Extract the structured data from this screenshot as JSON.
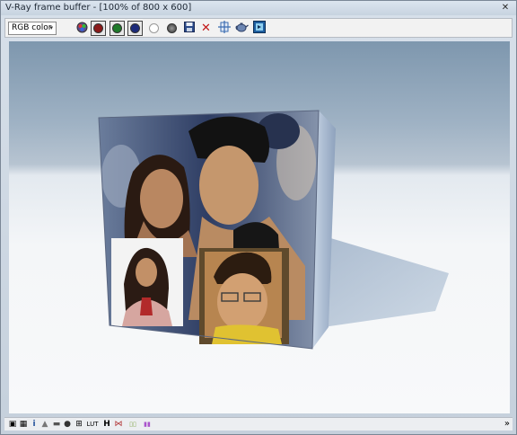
{
  "window": {
    "title": "V-Ray frame buffer - [100% of 800 x 600]",
    "close_glyph": "✕"
  },
  "toolbar": {
    "channel_select": {
      "value": "RGB color",
      "arrow": "▾"
    },
    "buttons": [
      {
        "name": "rgb-channels-icon",
        "color": "#6b5fa0"
      },
      {
        "name": "red-channel-icon",
        "color": "#8b1a1a"
      },
      {
        "name": "green-channel-icon",
        "color": "#1f7a2a"
      },
      {
        "name": "blue-channel-icon",
        "color": "#1c2a7a"
      },
      {
        "name": "alpha-channel-icon",
        "color": "#ffffff"
      },
      {
        "name": "mono-mode-icon",
        "color": "#555555"
      },
      {
        "name": "save-image-icon",
        "color": "#2b4a8a"
      },
      {
        "name": "clear-image-icon",
        "glyph": "✕",
        "color": "#c21818"
      },
      {
        "name": "duplicate-to-max-icon",
        "color": "#3a6bb0"
      },
      {
        "name": "render-last-icon",
        "color": "#4a6a9a"
      },
      {
        "name": "vfb-history-icon",
        "color": "#1f5fa0"
      }
    ]
  },
  "statusbar": {
    "icons": [
      {
        "name": "display-correction-icon",
        "glyph": "▣"
      },
      {
        "name": "pixel-info-icon",
        "glyph": "▦"
      },
      {
        "name": "info-icon",
        "glyph": "i"
      },
      {
        "name": "levels-icon",
        "glyph": "▲"
      },
      {
        "name": "curve-icon",
        "glyph": "▬"
      },
      {
        "name": "exposure-icon",
        "glyph": "●"
      },
      {
        "name": "srgb-icon",
        "glyph": "⊞"
      },
      {
        "name": "lut-icon",
        "glyph": "LUT"
      },
      {
        "name": "histogram-icon",
        "glyph": "H"
      },
      {
        "name": "compare-icon",
        "glyph": "⋈"
      },
      {
        "name": "stereo-icon",
        "glyph": "▯▯"
      },
      {
        "name": "color-swatch-icon",
        "glyph": "▮▮"
      }
    ],
    "expand_glyph": "»"
  }
}
